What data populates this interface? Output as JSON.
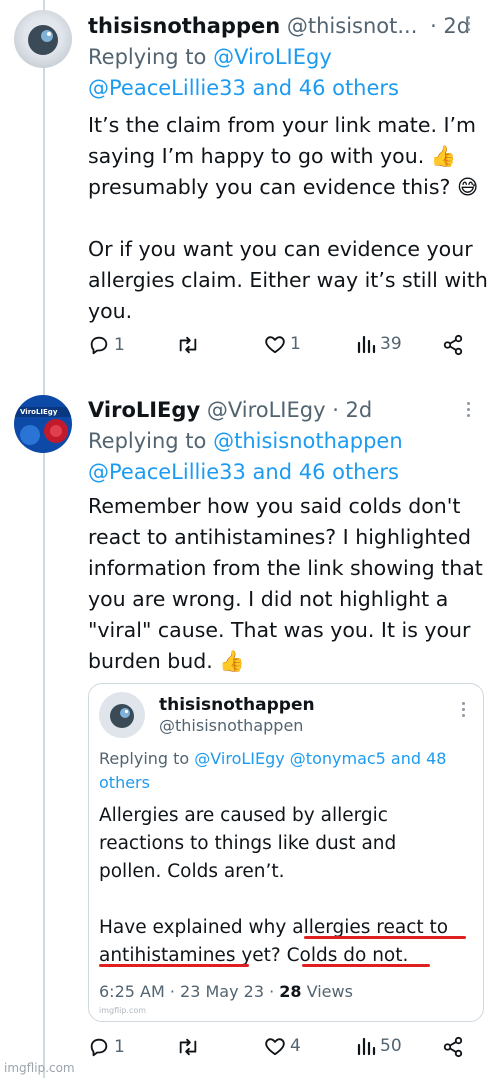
{
  "post1": {
    "display_name": "thisisnothappen",
    "handle": "@thisisnot...",
    "time": "· 2d",
    "replying_prefix": "Replying to",
    "reply_link_1": "@ViroLIEgy",
    "reply_link_2": "@PeaceLillie33 and 46 others",
    "body": "It’s the claim from your link mate. I’m\nsaying I’m happy to go with you. 👍\npresumably you can evidence this? 😅\n\nOr if you want you can evidence your\nallergies claim. Either way it’s still with\nyou.",
    "replies": "1",
    "retweets": "",
    "likes": "1",
    "views": "39"
  },
  "post2": {
    "display_name": "ViroLIEgy",
    "handle": "@ViroLIEgy",
    "time": "· 2d",
    "replying_prefix": "Replying to",
    "reply_link_1": "@thisisnothappen",
    "reply_link_2": "@PeaceLillie33 and 46 others",
    "body": "Remember how you said colds don't\nreact to antihistamines? I highlighted\ninformation from the link showing that\nyou are wrong. I did not highlight a\n\"viral\" cause. That was you. It is your\nburden bud. 👍",
    "replies": "1",
    "retweets": "",
    "likes": "4",
    "views": "50",
    "avatar_text": "ViroLIEgy"
  },
  "quote": {
    "display_name": "thisisnothappen",
    "handle": "@thisisnothappen",
    "replying_prefix": "Replying to",
    "reply_links": "@ViroLIEgy @tonymac5 and 48\nothers",
    "body": "Allergies are caused by allergic\nreactions to things like dust and\npollen. Colds aren’t.\n\nHave explained why allergies react to\nantihistamines yet? Colds do not.",
    "time": "6:25 AM · 23 May 23 · ",
    "view_count": "28",
    "views_label": " Views",
    "watermark": "imgflip.com"
  },
  "watermark": "imgflip.com",
  "colors": {
    "link": "#1d9bf0",
    "secondary": "#536471",
    "highlight_underline": "#e02020"
  }
}
